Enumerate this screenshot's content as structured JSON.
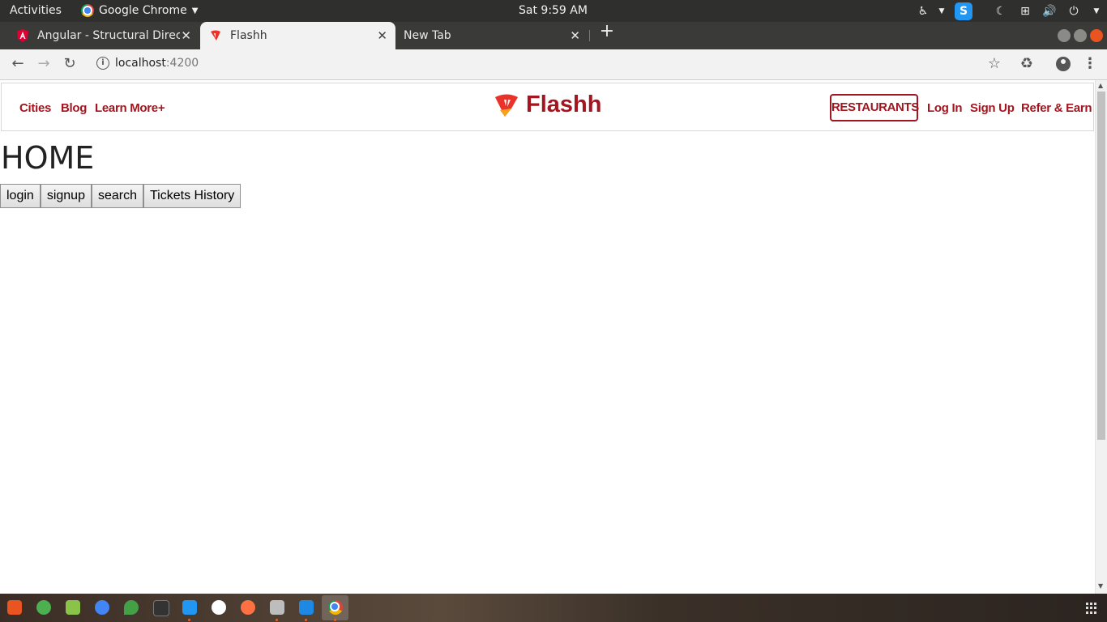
{
  "system_bar": {
    "activities": "Activities",
    "app_name": "Google Chrome",
    "clock": "Sat  9:59 AM"
  },
  "tabs": [
    {
      "label": "Angular - Structural Direc",
      "state": "inactive"
    },
    {
      "label": "Flashh",
      "state": "active"
    },
    {
      "label": "New Tab",
      "state": "inactive"
    }
  ],
  "address_bar": {
    "host": "localhost",
    "port": ":4200"
  },
  "site_nav": {
    "left_links": [
      "Cities",
      "Blog",
      "Learn More+"
    ],
    "brand": "Flashh",
    "restaurants_button": "RESTAURANTS",
    "right_links": [
      "Log In",
      "Sign Up",
      "Refer & Earn"
    ]
  },
  "page": {
    "title": "HOME",
    "buttons": [
      "login",
      "signup",
      "search",
      "Tickets History"
    ]
  },
  "colors": {
    "brand": "#a3151f",
    "system_bar": "#2f2f2d",
    "tab_strip": "#3a3a38"
  }
}
